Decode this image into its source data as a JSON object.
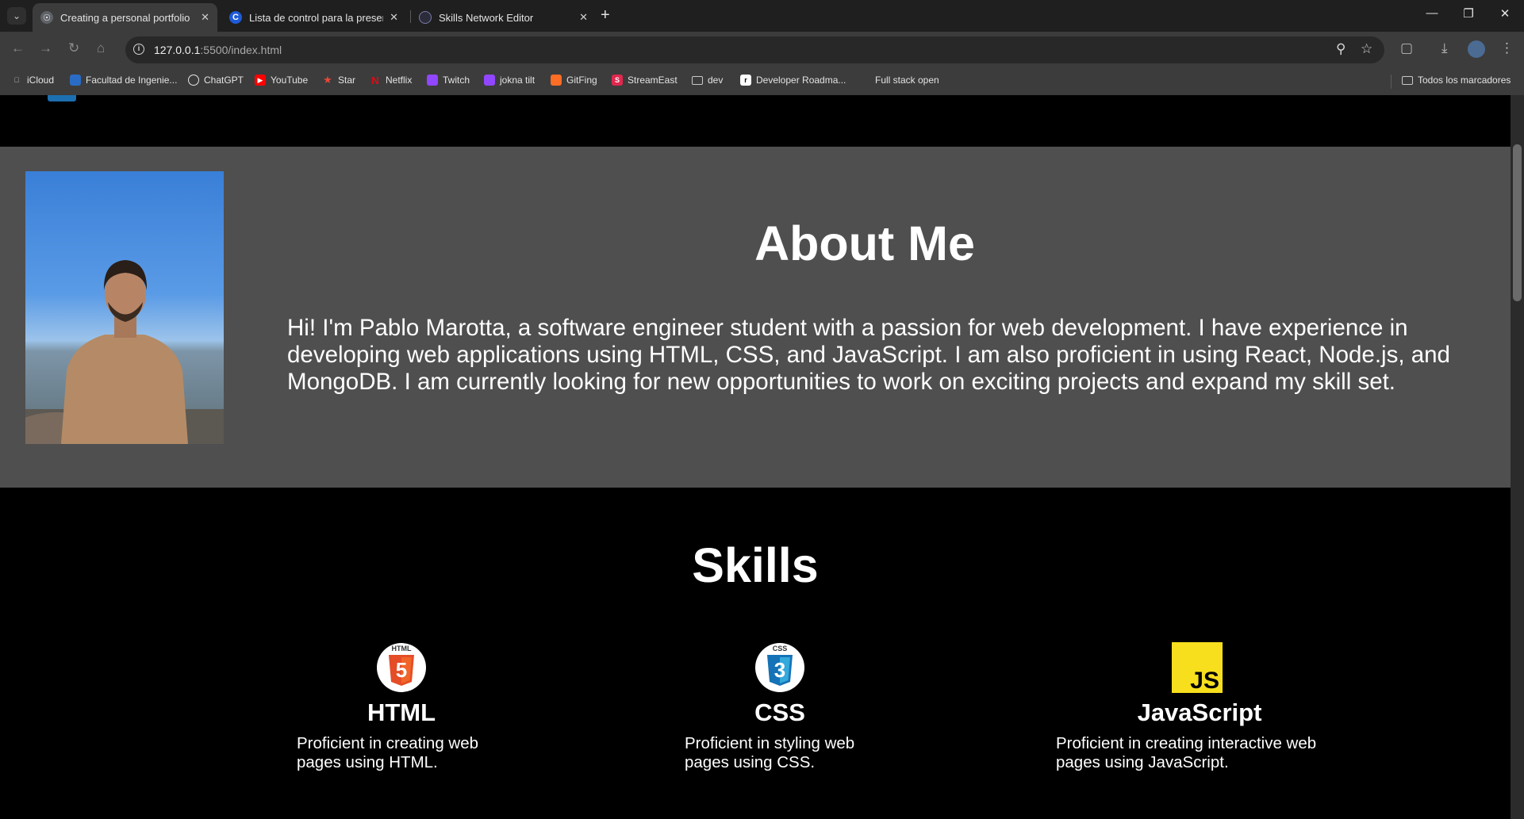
{
  "browser": {
    "tabs": [
      {
        "title": "Creating a personal portfolio",
        "favicon": "globe-icon",
        "active": true
      },
      {
        "title": "Lista de control para la presentación",
        "favicon": "c-logo-icon",
        "active": false
      },
      {
        "title": "Skills Network Editor",
        "favicon": "skills-network-icon",
        "active": false
      }
    ],
    "url_host": "127.0.0.1",
    "url_path": ":5500/index.html",
    "bookmarks": [
      {
        "label": "iCloud",
        "icon": "apple-icon",
        "color": "#c8c8c8"
      },
      {
        "label": "Facultad de Ingenie...",
        "icon": "facultad-icon",
        "color": "#2a6cc4"
      },
      {
        "label": "ChatGPT",
        "icon": "chatgpt-icon",
        "color": "#e6e6e6"
      },
      {
        "label": "YouTube",
        "icon": "youtube-icon",
        "color": "#ff0000"
      },
      {
        "label": "Star",
        "icon": "star-icon",
        "color": "#e8483a"
      },
      {
        "label": "Netflix",
        "icon": "netflix-icon",
        "color": "#e50914"
      },
      {
        "label": "Twitch",
        "icon": "twitch-icon",
        "color": "#9146ff"
      },
      {
        "label": "jokna tilt",
        "icon": "twitch-icon",
        "color": "#9146ff"
      },
      {
        "label": "GitFing",
        "icon": "gitlab-icon",
        "color": "#fc6d26"
      },
      {
        "label": "StreamEast",
        "icon": "streameast-icon",
        "color": "#e0284f"
      },
      {
        "label": "dev",
        "icon": "folder-icon",
        "color": "#c8c8c8"
      },
      {
        "label": "Developer Roadma...",
        "icon": "roadmap-icon",
        "color": "#ffffff"
      },
      {
        "label": "Full stack open",
        "icon": "none",
        "color": "#3c3c3c"
      }
    ],
    "all_bookmarks_label": "Todos los marcadores"
  },
  "about": {
    "title": "About Me",
    "text": "Hi! I'm Pablo Marotta, a software engineer student with a passion for web development. I have experience in developing web applications using HTML, CSS, and JavaScript. I am also proficient in using React, Node.js, and MongoDB. I am currently looking for new opportunities to work on exciting projects and expand my skill set."
  },
  "skills": {
    "title": "Skills",
    "items": [
      {
        "name": "HTML",
        "icon": "html5-icon",
        "color": "#e44d26",
        "badge": "5",
        "badge_top": "HTML",
        "desc": "Proficient in creating web pages using HTML."
      },
      {
        "name": "CSS",
        "icon": "css3-icon",
        "color": "#1572b6",
        "badge": "3",
        "badge_top": "CSS",
        "desc": "Proficient in styling web pages using CSS."
      },
      {
        "name": "JavaScript",
        "icon": "javascript-icon",
        "color": "#f7df1e",
        "badge": "JS",
        "desc": "Proficient in creating interactive web pages using JavaScript."
      }
    ]
  }
}
